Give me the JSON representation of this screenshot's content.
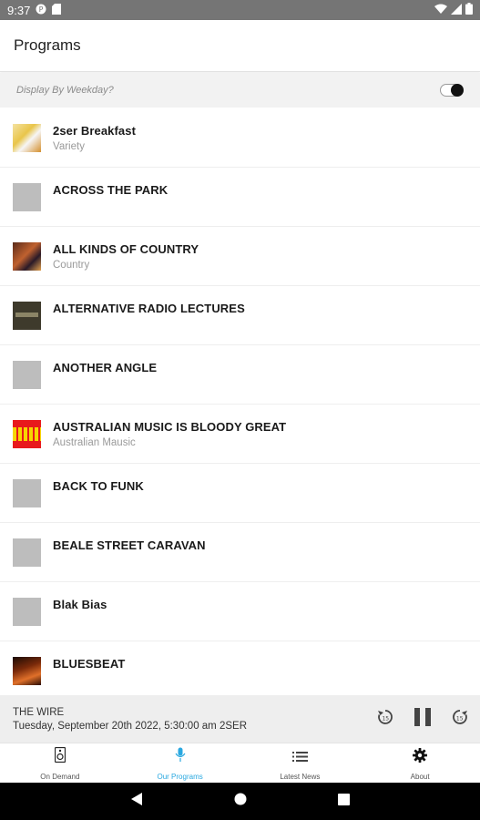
{
  "status_bar": {
    "time": "9:37",
    "icons": [
      "data-saver-icon",
      "sd-card-icon",
      "wifi-icon",
      "signal-icon",
      "battery-icon"
    ]
  },
  "app_bar": {
    "title": "Programs"
  },
  "weekday_toggle": {
    "label": "Display By Weekday?",
    "enabled": true
  },
  "programs": [
    {
      "name": "2ser Breakfast",
      "genre": "Variety",
      "art": "art1"
    },
    {
      "name": "ACROSS THE PARK",
      "genre": "",
      "art": ""
    },
    {
      "name": "ALL KINDS OF COUNTRY",
      "genre": "Country",
      "art": "art2"
    },
    {
      "name": "ALTERNATIVE RADIO LECTURES",
      "genre": "",
      "art": "art3"
    },
    {
      "name": "ANOTHER ANGLE",
      "genre": "",
      "art": ""
    },
    {
      "name": "AUSTRALIAN MUSIC IS BLOODY GREAT",
      "genre": "Australian Mausic",
      "art": "art4"
    },
    {
      "name": "BACK TO FUNK",
      "genre": "",
      "art": ""
    },
    {
      "name": "BEALE STREET CARAVAN",
      "genre": "",
      "art": ""
    },
    {
      "name": "Blak Bias",
      "genre": "",
      "art": ""
    },
    {
      "name": "BLUESBEAT",
      "genre": "",
      "art": "art5"
    }
  ],
  "player": {
    "show": "THE WIRE",
    "when": "Tuesday, September 20th 2022, 5:30:00 am 2SER",
    "controls": [
      "rewind-icon",
      "pause-icon",
      "forward-icon"
    ]
  },
  "bottom_nav": {
    "tabs": [
      {
        "label": "On Demand",
        "icon": "speaker-icon",
        "active": false
      },
      {
        "label": "Our Programs",
        "icon": "microphone-icon",
        "active": true
      },
      {
        "label": "Latest News",
        "icon": "list-icon",
        "active": false
      },
      {
        "label": "About",
        "icon": "gear-icon",
        "active": false
      }
    ]
  },
  "colors": {
    "accent": "#29a8e0",
    "status_bar": "#757575",
    "player_bg": "#eeeeee"
  }
}
